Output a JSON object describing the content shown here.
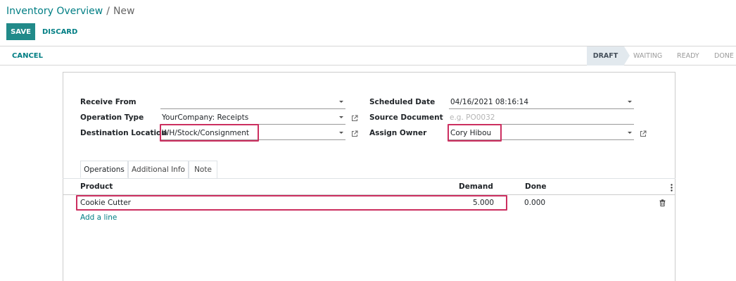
{
  "breadcrumb": {
    "parent": "Inventory Overview",
    "separator": "/",
    "current": "New"
  },
  "actions": {
    "save": "SAVE",
    "discard": "DISCARD"
  },
  "statusbar": {
    "cancel": "CANCEL",
    "steps": [
      "DRAFT",
      "WAITING",
      "READY",
      "DONE"
    ],
    "active_step": "DRAFT"
  },
  "form": {
    "receive_from": {
      "label": "Receive From",
      "value": ""
    },
    "operation_type": {
      "label": "Operation Type",
      "value": "YourCompany: Receipts"
    },
    "destination_location": {
      "label": "Destination Location",
      "value": "WH/Stock/Consignment"
    },
    "scheduled_date": {
      "label": "Scheduled Date",
      "value": "04/16/2021 08:16:14"
    },
    "source_document": {
      "label": "Source Document",
      "placeholder": "e.g. PO0032",
      "value": ""
    },
    "assign_owner": {
      "label": "Assign Owner",
      "value": "Cory Hibou"
    }
  },
  "tabs": [
    "Operations",
    "Additional Info",
    "Note"
  ],
  "active_tab": "Operations",
  "table": {
    "columns": {
      "product": "Product",
      "demand": "Demand",
      "done": "Done"
    },
    "rows": [
      {
        "product": "Cookie Cutter",
        "demand": "5.000",
        "done": "0.000"
      }
    ],
    "add_line": "Add a line"
  },
  "colors": {
    "accent": "#017e84",
    "save_bg": "#218a89",
    "highlight": "#cc2f60"
  },
  "icons": [
    "external-link-icon",
    "dropdown-caret-icon",
    "kebab-menu-icon",
    "trash-icon"
  ]
}
